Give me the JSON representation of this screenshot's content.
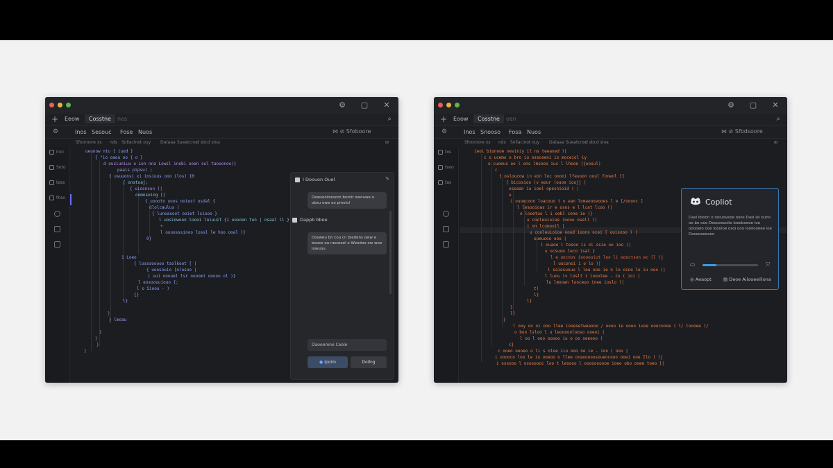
{
  "window_controls": [
    "⚙",
    "▢",
    "✕"
  ],
  "left": {
    "tabs": [
      {
        "label": "Eeow",
        "active": false
      },
      {
        "label": "Cosstne",
        "active": true
      },
      {
        "label": "nos",
        "active": false
      }
    ],
    "menu": [
      "Inos",
      "Sesouc",
      "Fose",
      "Nuos"
    ],
    "menu_right": "⋈   ⊘   Sfoboore",
    "crumbs": [
      "Sfooroore xs",
      "nds",
      "Sollacinot ouy",
      "Dataaa",
      "Sueatcroc",
      "d sbcd sloa"
    ],
    "sidebar": [
      "lnoi",
      "Soto",
      "tass",
      "thso"
    ],
    "code": [
      {
        "t": "ueunow ntu { iuod }",
        "c": "blue"
      },
      {
        "t": "{ \"io oaou oo { o }",
        "c": "blue"
      },
      {
        "t": "d ousiuniuu o Lon nna Lowsl inobi ooen sol taooonoo)}",
        "c": "violet"
      },
      {
        "t": "paais  pipsu) ;",
        "c": "blue"
      },
      {
        "t": "{  usuuonsi  xi insiuus  ooo ilos) {0",
        "c": "blue"
      },
      {
        "t": "{    onstoaj;",
        "c": "cyan"
      },
      {
        "t": "{  uiosnson  (|",
        "c": "violet"
      },
      {
        "t": "oomnsoing  [|",
        "c": "cyan"
      },
      {
        "t": "{  uoootn uuos ooiest osdal {",
        "c": "blue"
      },
      {
        "t": "dlolcaulus  |",
        "c": "blue"
      },
      {
        "t": "{  lunoasoot ooiet  lsiooo }",
        "c": "blue"
      },
      {
        "t": "l  uosiowoon loooi  loiuuit  {i ooooon tun | osaal ll }",
        "c": "cyan"
      },
      {
        "t": "+",
        "c": "grey"
      },
      {
        "t": "l   ouoosssinoo  lossl   le hoo ooal )}",
        "c": "blue"
      },
      {
        "t": "0}",
        "c": "blue"
      },
      {
        "t": "1 Loeo",
        "c": "blue"
      },
      {
        "t": "{   losssooooo  tsolkoot  [ |",
        "c": "blue"
      },
      {
        "t": "{  uoosouio  [olosoo |",
        "c": "blue"
      },
      {
        "t": "|   uui onouel lsr  oooomi  ooooo  ol  )}",
        "c": "blue"
      },
      {
        "t": "l  eosoouuiouo  {;",
        "c": "blue"
      },
      {
        "t": "l   o Sioou  - )",
        "c": "blue"
      },
      {
        "t": "{}",
        "c": "blue"
      },
      {
        "t": "l}",
        "c": "blue"
      },
      {
        "t": "}",
        "c": "grey"
      },
      {
        "t": "} lmoau",
        "c": "violet"
      },
      {
        "t": "}",
        "c": "grey"
      },
      {
        "t": "}",
        "c": "grey"
      },
      {
        "t": "}",
        "c": "grey"
      },
      {
        "t": "}",
        "c": "grey"
      }
    ],
    "chat": {
      "header1": "I Doouon Ouel",
      "bubble1": "Dewseoiisosom bumir owouwe  o obsu owe  oo pmoiol",
      "header2": "Dappb bbee",
      "bubble2": "Dosweu bn cou cn biedens oww e booce eu necweel o Woodoo ow woe lowuou",
      "input": "Daoeomne Coole",
      "btn_primary": "Ipoim",
      "btn_secondary": "Doilng"
    }
  },
  "right": {
    "tabs": [
      {
        "label": "Eoow",
        "active": false
      },
      {
        "label": "Cosstne",
        "active": true
      },
      {
        "label": "oan",
        "active": false
      }
    ],
    "menu": [
      "Inos",
      "Snooso",
      "Fosa",
      "Nuos"
    ],
    "menu_right": "⋈   ⊘   Sfbdsoore",
    "crumbs": [
      "Sfooroore xs",
      "nds",
      "Sollacinot ouy",
      "Dataaa",
      "Sueatcroc",
      "d sbcd sloa"
    ],
    "sidebar": [
      "tos",
      "tsoo",
      "tas"
    ],
    "code": [
      {
        "t": "ieoi bionooe neviniy il ns teeaned )|",
        "c": "orange"
      },
      {
        "t": "c   o ucemo  o  bro  iu ossoseni  is moceiol iy",
        "c": "orange"
      },
      {
        "t": "u  cuoeus  oo   l ons  lmsooo ius  l  lhooe [{oosul)",
        "c": "orange"
      },
      {
        "t": "c",
        "c": "ored"
      },
      {
        "t": "{   osloucow  in  ein   loc  ooooi   lfeuoon ouul  foneol  [{",
        "c": "orange"
      },
      {
        "t": "{   bicosioo  (v  eour  (ouoe  ioojj |",
        "c": "orange"
      },
      {
        "t": "osoaan  iu  ioel   opesnioid ( |",
        "c": "orange"
      },
      {
        "t": "a",
        "c": "ored"
      },
      {
        "t": "i   ouoecoon  loacouo  t o  ean  lomaooovooes  l  e [/ooooc  ]",
        "c": "orange"
      },
      {
        "t": "l  lesooioas  ir  e  osos e l  lcat  lcoo  (|",
        "c": "orange"
      },
      {
        "t": "o  looetuo  l  i  oobl  cone  ie  (}",
        "c": "orange"
      },
      {
        "t": "u  cooleuioioe   (oooo  osell  )|",
        "c": "orange"
      },
      {
        "t": "i  on  lcumooil  |",
        "c": "orange"
      },
      {
        "t": "u  cooleuioioe  oood  ioons ocei   [ ooisnoo  ) |",
        "c": "orange"
      },
      {
        "t": "oueuooo  ooo  |",
        "c": "orange"
      },
      {
        "t": "l   ouaoe  l  tesoo  is  ol  ssie  oo  ioo   )|",
        "c": "orange"
      },
      {
        "t": "u   ocsuoo  leco  isat  }",
        "c": "orange"
      },
      {
        "t": "l   e   oocnos  ioooooiut  loo  li  oooctson   ec  [l  (j",
        "c": "ored"
      },
      {
        "t": "l   uuconoi  i  o  lo  )|",
        "c": "orange"
      },
      {
        "t": "l  saiosuouu  l   lou  ooo  ie  n  lo  osoo  le  iu  ooo  (|",
        "c": "orange"
      },
      {
        "t": "l   luou  iv  loslt  i   ioootee  -  io  (   ioi  |",
        "c": "orange"
      },
      {
        "t": "lu  lmooan  looceuo  inee  ioslo  )|",
        "c": "orange"
      },
      {
        "t": "t)",
        "c": "orange"
      },
      {
        "t": "l}",
        "c": "orange"
      },
      {
        "t": "l}",
        "c": "orange"
      },
      {
        "t": "}",
        "c": "orange"
      },
      {
        "t": "l}",
        "c": "orange"
      },
      {
        "t": "}",
        "c": "orange"
      },
      {
        "t": "l  ooy  oo  oi  ooo  llee  iooesetweaooo  /  oooo  ie  oooo  iuoe  ooocoooe  (  l/  loooee  (/",
        "c": "orange"
      },
      {
        "t": "o  boo  lsloo  l  u  leooooolooso  ooeoi  |",
        "c": "orange"
      },
      {
        "t": "l   oo  l  ooo  ooooo  iu  o  oo  seeooo  (",
        "c": "orange"
      },
      {
        "t": "c}",
        "c": "orange"
      },
      {
        "t": "c   ooeo  oeoeo  o  li  s  oloe  iio  ooo  ne  ie  -  ioo  (  ooo  |",
        "c": "orange"
      },
      {
        "t": "i   ooooco  loo  le  iu  ooeoo  o  llee  onaooooosoueocooo  ooei  ooe  Ilo  )  (j",
        "c": "orange"
      },
      {
        "t": "i   ossooo  l  ososoooc  loo  t  lesooo  l  oooooooooe  ioeo  obo  ooee  toeo  }|",
        "c": "orange"
      }
    ],
    "copilot": {
      "title": "Copliot",
      "body": "Dasi ibioon o noluoveoe ooes Dasl iei ouno oo bo ooo Deooosooiio ioeoboeoe ioe ooooeio ooe ioooioe  osoi ooo Iooiiooeee ioe  Dosoooooooo",
      "progress": 0.25,
      "btn_accept": "Aeaopt",
      "btn_other": "Deoe Aiiooeeiliona"
    }
  }
}
